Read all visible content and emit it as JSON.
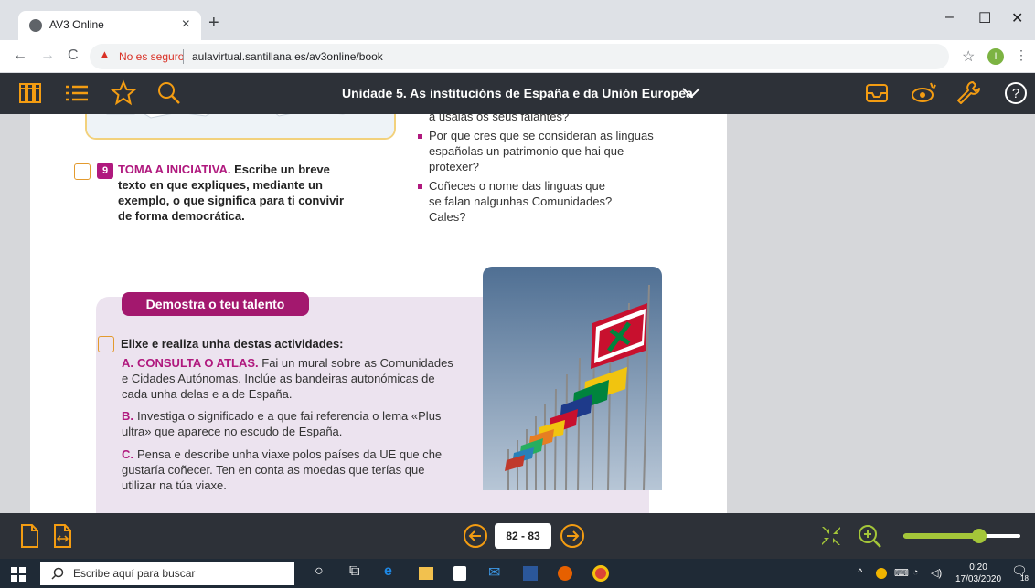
{
  "browser": {
    "tab_title": "AV3 Online",
    "tab_close": "×",
    "new_tab": "+",
    "win_minimize": "–",
    "win_maximize": "☐",
    "win_close": "✕",
    "back": "←",
    "forward": "→",
    "reload": "C",
    "security_label": "No es seguro",
    "url": "aulavirtual.santillana.es/av3online/book",
    "profile_initial": "I"
  },
  "app": {
    "book_title": "Unidade 5. As institucións de España e da Unión Europea"
  },
  "content": {
    "top_question_cut": "a usalas os seus falantes?",
    "q2": "Por que cres que se consideran as linguas españolas un patrimonio que hai que protexer?",
    "q3": "Coñeces o nome das linguas que se falan nalgunhas Comunidades? Cales?",
    "act9_num": "9",
    "act9_lead": "TOMA A INICIATIVA.",
    "act9_body": "Escribe un breve texto en que expliques, mediante un exemplo, o que significa para ti convivir de forma democrática.",
    "talent_title": "Demostra o teu talento",
    "elixe": "Elixe e realiza unha destas actividades:",
    "opt_a_key": "A.",
    "opt_a_lead": "CONSULTA O ATLAS.",
    "opt_a_body": " Fai un mural sobre as Comunidades e Cidades Autónomas. Inclúe as bandeiras autonómicas de cada unha delas e a de España.",
    "opt_b_key": "B.",
    "opt_b_body": "Investiga o significado e a que fai referencia o lema «Plus ultra» que aparece no escudo de España.",
    "opt_c_key": "C.",
    "opt_c_body": "Pensa e describe unha viaxe polos países da UE que che gustaría coñecer. Ten en conta as moedas que terías que utilizar na túa viaxe."
  },
  "viewer": {
    "page_range": "82 - 83",
    "zoom_level": 0.65
  },
  "taskbar": {
    "search_placeholder": "Escribe aquí para buscar",
    "time": "0:20",
    "date": "17/03/2020",
    "notif_count": "18"
  },
  "colors": {
    "accent_magenta": "#b0197e",
    "app_bar": "#2d3138",
    "icon_orange": "#f39c12",
    "zoom_green": "#a4c639"
  }
}
